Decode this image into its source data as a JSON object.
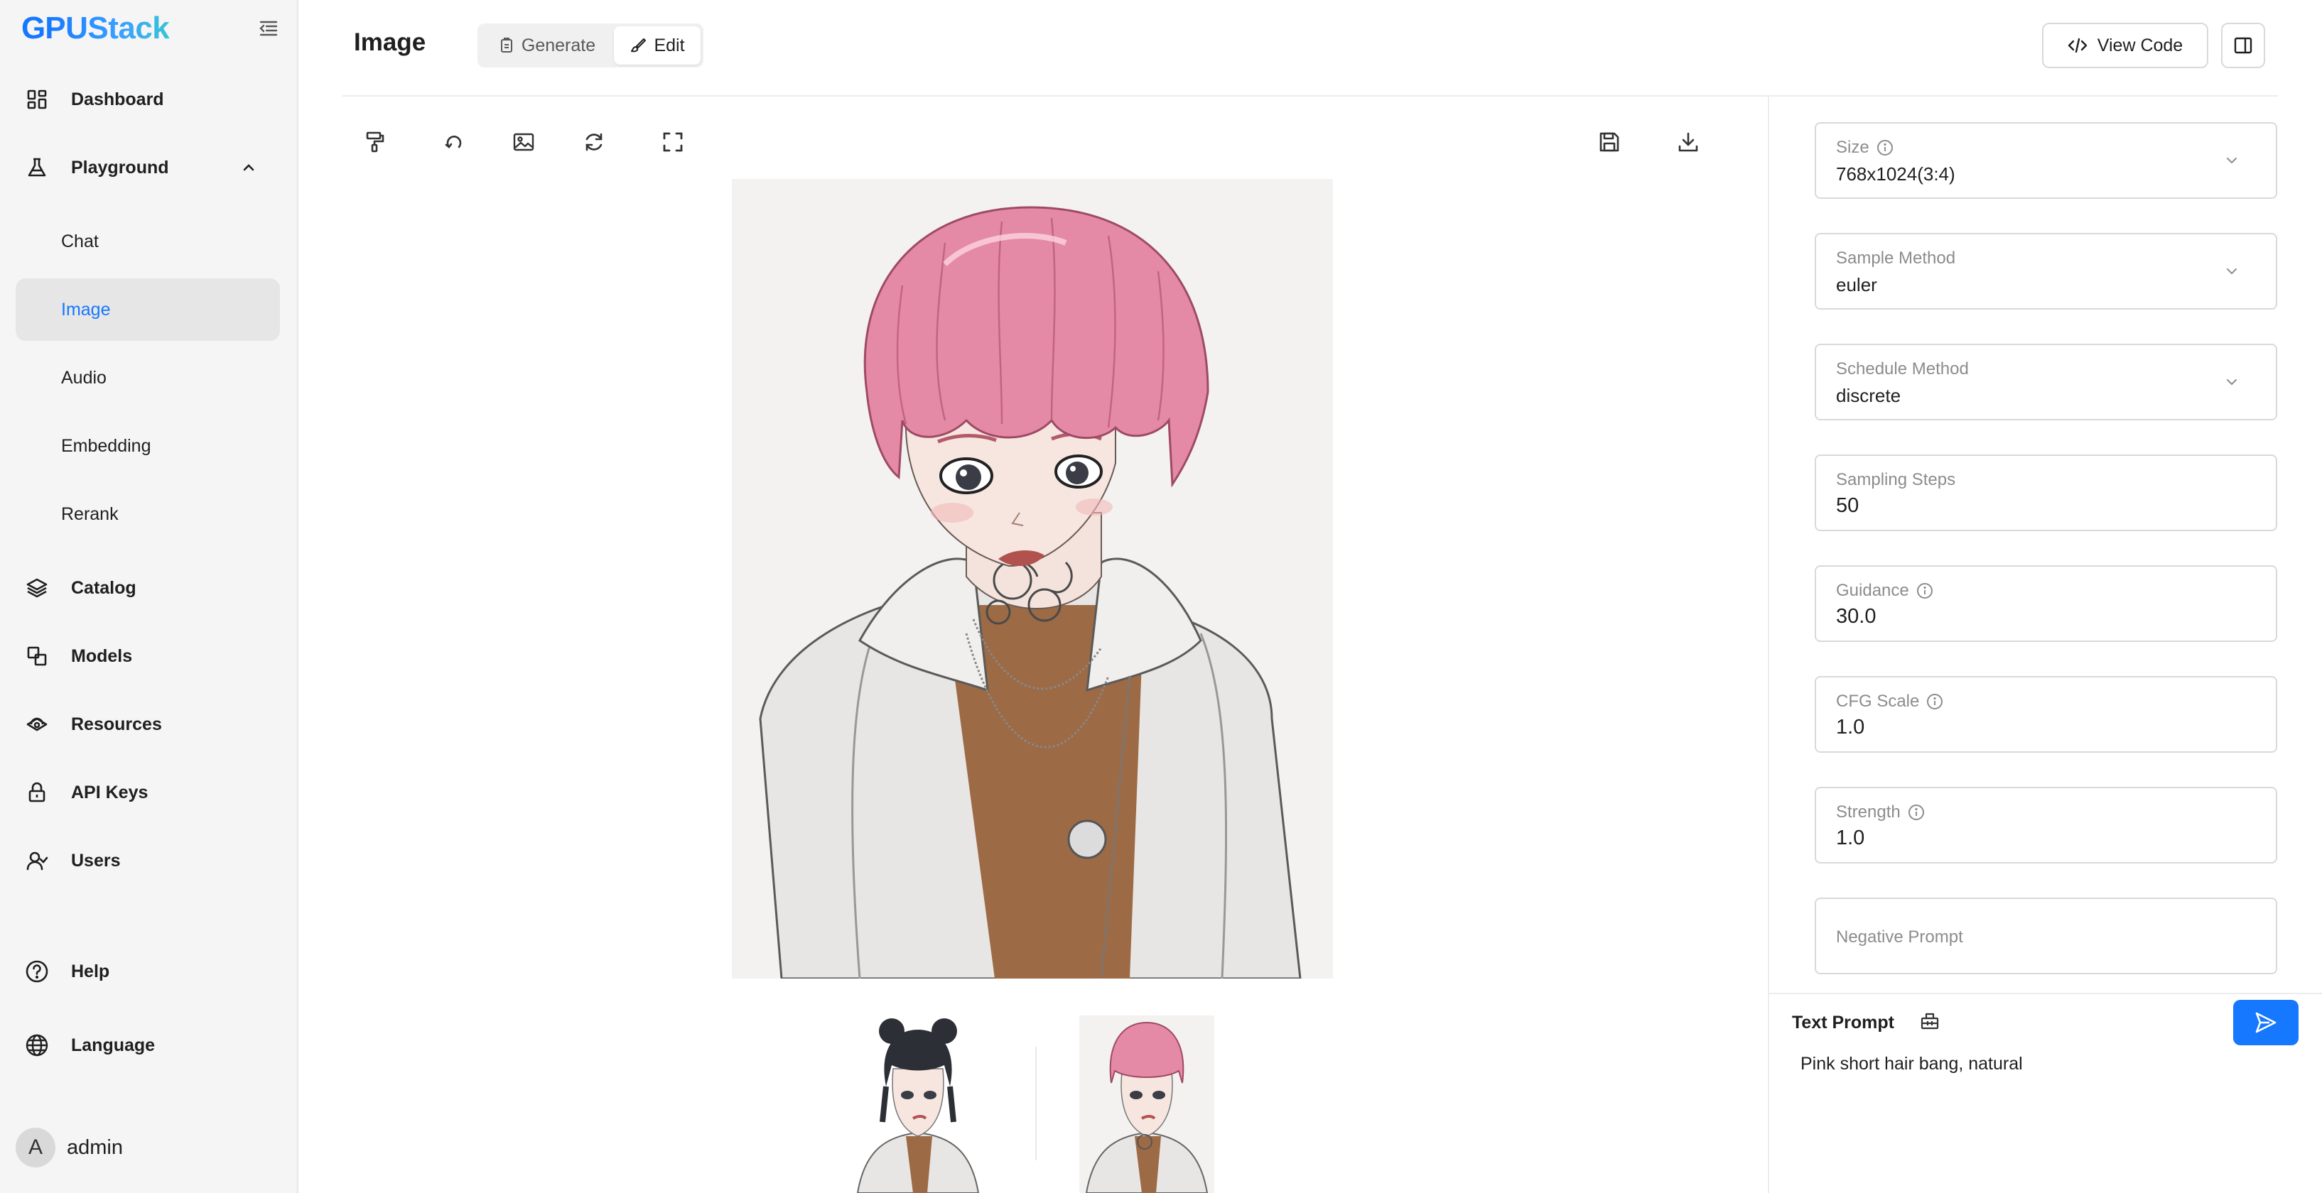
{
  "brand": {
    "logo_first": "G",
    "logo_rest": "PUStack"
  },
  "sidebar": {
    "items": [
      {
        "label": "Dashboard",
        "icon": "dashboard-icon"
      },
      {
        "label": "Playground",
        "icon": "flask-icon"
      },
      {
        "label": "Catalog",
        "icon": "layers-icon"
      },
      {
        "label": "Models",
        "icon": "models-icon"
      },
      {
        "label": "Resources",
        "icon": "resources-icon"
      },
      {
        "label": "API Keys",
        "icon": "lock-icon"
      },
      {
        "label": "Users",
        "icon": "users-icon"
      }
    ],
    "sub_items": [
      {
        "label": "Chat"
      },
      {
        "label": "Image",
        "active": true
      },
      {
        "label": "Audio"
      },
      {
        "label": "Embedding"
      },
      {
        "label": "Rerank"
      }
    ],
    "footer": [
      {
        "label": "Help",
        "icon": "help-icon"
      },
      {
        "label": "Language",
        "icon": "globe-icon"
      }
    ],
    "user": {
      "initial": "A",
      "name": "admin"
    }
  },
  "header": {
    "title": "Image",
    "tabs": [
      {
        "label": "Generate"
      },
      {
        "label": "Edit",
        "active": true
      }
    ],
    "view_code_label": "View Code"
  },
  "toolbar": {
    "left_icons": [
      "paint-roller-icon",
      "undo-icon",
      "image-icon",
      "refresh-icon",
      "fullscreen-icon"
    ],
    "right_icons": [
      "save-icon",
      "download-icon"
    ]
  },
  "params": {
    "size": {
      "label": "Size",
      "value": "768x1024(3:4)"
    },
    "sample_method": {
      "label": "Sample Method",
      "value": "euler"
    },
    "schedule_method": {
      "label": "Schedule Method",
      "value": "discrete"
    },
    "sampling_steps": {
      "label": "Sampling Steps",
      "value": "50"
    },
    "guidance": {
      "label": "Guidance",
      "value": "30.0"
    },
    "cfg_scale": {
      "label": "CFG Scale",
      "value": "1.0"
    },
    "strength": {
      "label": "Strength",
      "value": "1.0"
    },
    "negative_prompt": {
      "placeholder": "Negative Prompt"
    }
  },
  "prompt": {
    "title": "Text Prompt",
    "text": "Pink short hair bang, natural"
  },
  "colors": {
    "accent": "#1677ff",
    "sidebar_bg": "#f5f5f5",
    "active_bg": "#e6e6e6",
    "border": "#d9d9d9"
  }
}
